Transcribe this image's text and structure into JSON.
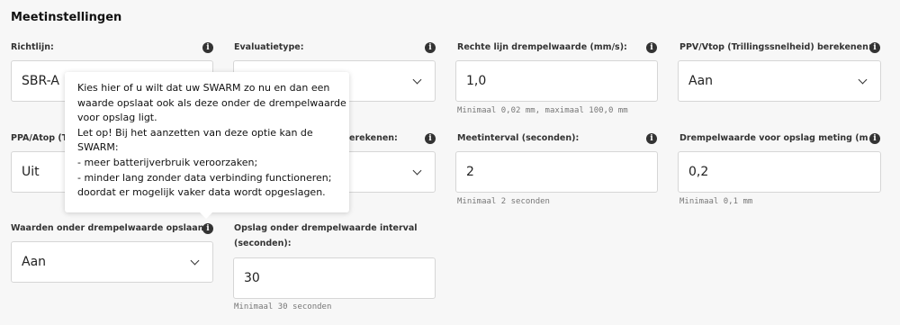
{
  "section": {
    "title": "Meetinstellingen"
  },
  "fields": {
    "richtlijn": {
      "label": "Richtlijn:",
      "value": "SBR-A"
    },
    "evaluatietype": {
      "label": "Evaluatietype:",
      "value": ""
    },
    "rechte_lijn": {
      "label": "Rechte lijn drempelwaarde (mm/s):",
      "value": "1,0",
      "hint": "Minimaal 0,02 mm, maximaal 100,0 mm"
    },
    "ppv_vtop": {
      "label": "PPV/Vtop (Trillingssnelheid) berekenen:",
      "value": "Aan"
    },
    "ppa_atop": {
      "label": "PPA/Atop (T",
      "value": "Uit"
    },
    "second_row_select": {
      "label": "erekenen:",
      "value": ""
    },
    "meetinterval": {
      "label": "Meetinterval (seconden):",
      "value": "2",
      "hint": "Minimaal 2 seconden"
    },
    "drempel_opslag": {
      "label": "Drempelwaarde voor opslag meting (mm/s",
      "value": "0,2",
      "hint": "Minimaal 0,1 mm"
    },
    "waarden_onder": {
      "label": "Waarden onder drempelwaarde opslaan:",
      "value": "Aan"
    },
    "opslag_interval": {
      "label_line1": "Opslag onder drempelwaarde interval",
      "label_line2": "(seconden):",
      "value": "30",
      "hint": "Minimaal 30 seconden"
    }
  },
  "tooltip": {
    "lines": [
      "Kies hier of u wilt dat uw SWARM zo nu en dan een",
      "waarde opslaat ook als deze onder de drempelwaarde",
      "voor opslag ligt.",
      "Let op! Bij het aanzetten van deze optie kan de",
      "SWARM:",
      "- meer batterijverbruik veroorzaken;",
      "- minder lang zonder data verbinding functioneren;",
      "doordat er mogelijk vaker data wordt opgeslagen."
    ]
  },
  "icons": {
    "info": "info-icon",
    "dropdown": "chevron-down-icon"
  },
  "info_glyph": "i"
}
